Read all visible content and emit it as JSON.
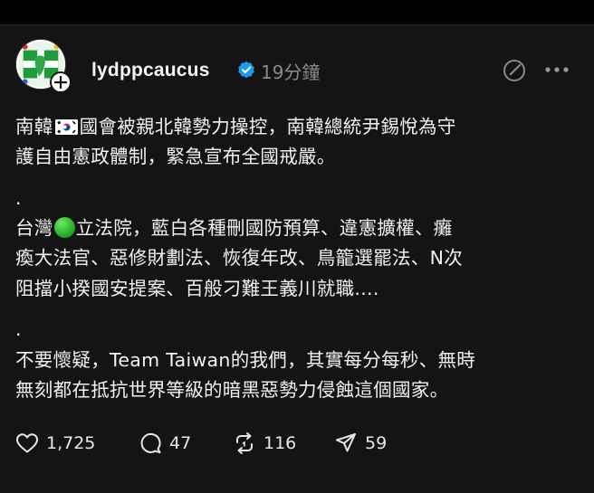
{
  "post": {
    "username": "lydppcaucus",
    "time": "19分鐘",
    "lines": [
      "南韓",
      "國會被親北韓勢力操控，南韓總統尹錫悅為守",
      "護自由憲政體制，緊急宣布全國戒嚴。",
      ".",
      "台灣",
      "立法院，藍白各種刪國防預算、違憲擴權、癱",
      "瘓大法官、惡修財劃法、恢復年改、鳥籠選罷法、N次",
      "阻擋小揆國安提案、百般刁難王義川就職....",
      ".",
      "不要懷疑，Team Taiwan的我們，其實每分每秒、無時",
      "無刻都在抵抗世界等級的暗黑惡勢力侵蝕這個國家。"
    ],
    "icons": {
      "flag": "south-korea-flag-icon",
      "dot": "green-circle-emoji"
    }
  },
  "actions": {
    "likes": "1,725",
    "replies": "47",
    "reposts": "116",
    "shares": "59"
  },
  "colors": {
    "background": "#141414",
    "text": "#f2f2f2",
    "muted": "#8a8a8a",
    "verified": "#1d9bf0"
  }
}
